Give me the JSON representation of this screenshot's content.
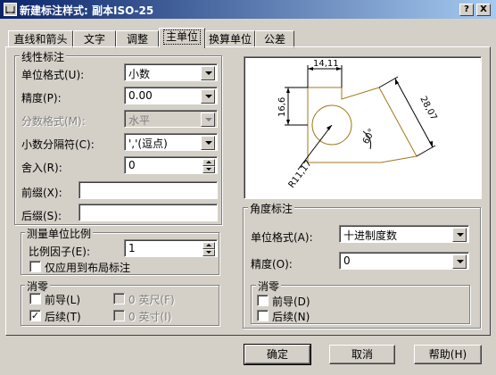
{
  "window": {
    "title": "新建标注样式: 副本ISO-25",
    "help_button": "?",
    "close_button": "X"
  },
  "tabs": [
    {
      "label": "直线和箭头"
    },
    {
      "label": "文字"
    },
    {
      "label": "调整"
    },
    {
      "label": "主单位",
      "active": true
    },
    {
      "label": "换算单位"
    },
    {
      "label": "公差"
    }
  ],
  "linear": {
    "title": "线性标注",
    "unit_format": {
      "label": "单位格式(U):",
      "value": "小数"
    },
    "precision": {
      "label": "精度(P):",
      "value": "0.00"
    },
    "fraction_format": {
      "label": "分数格式(M):",
      "value": "水平"
    },
    "decimal_separator": {
      "label": "小数分隔符(C):",
      "value": "','(逗点)"
    },
    "round_off": {
      "label": "舍入(R):",
      "value": "0"
    },
    "prefix": {
      "label": "前缀(X):",
      "value": ""
    },
    "suffix": {
      "label": "后缀(S):",
      "value": ""
    }
  },
  "scale": {
    "title": "测量单位比例",
    "factor": {
      "label": "比例因子(E):",
      "value": "1"
    },
    "layout_only": {
      "label": "仅应用到布局标注",
      "checked": false
    }
  },
  "zero_linear": {
    "title": "消零",
    "leading": {
      "label": "前导(L)",
      "checked": false
    },
    "trailing": {
      "label": "后续(T)",
      "checked": true
    },
    "feet": {
      "label": "0 英尺(F)",
      "checked": false
    },
    "inches": {
      "label": "0 英寸(I)",
      "checked": false
    }
  },
  "preview": {
    "dim_top": "14,11",
    "dim_left": "16,6",
    "dim_right": "28,07",
    "dim_angle": "60°",
    "dim_radius": "R11,17"
  },
  "angular": {
    "title": "角度标注",
    "unit_format": {
      "label": "单位格式(A):",
      "value": "十进制度数"
    },
    "precision": {
      "label": "精度(O):",
      "value": "0"
    }
  },
  "zero_angular": {
    "title": "消零",
    "leading": {
      "label": "前导(D)",
      "checked": false
    },
    "trailing": {
      "label": "后续(N)",
      "checked": false
    }
  },
  "buttons": {
    "ok": "确定",
    "cancel": "取消",
    "help": "帮助(H)"
  },
  "colors": {
    "titlebar_start": "#0a246a",
    "titlebar_end": "#a6caf0",
    "dialog_face": "#d4d0c8",
    "preview_geometry": "#a07818",
    "preview_dims": "#000000"
  }
}
